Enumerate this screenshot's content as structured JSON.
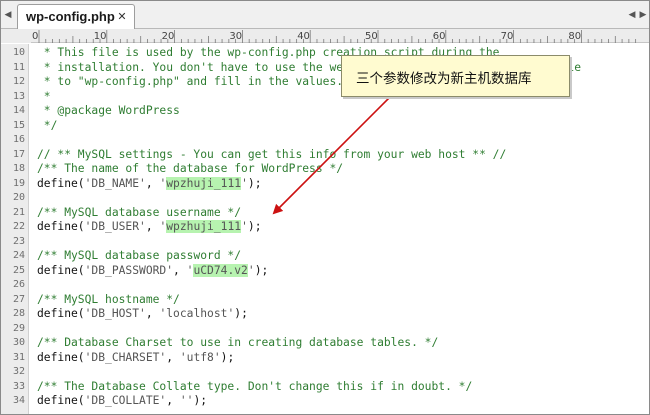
{
  "tab": {
    "title": "wp-config.php"
  },
  "ruler": {
    "labels": [
      "0",
      "10",
      "20",
      "30",
      "40",
      "50",
      "60",
      "70",
      "80"
    ]
  },
  "callout": {
    "text": "三个参数修改为新主机数据库"
  },
  "colors": {
    "comment": "#2f7d32",
    "highlight": "#b7f3b0",
    "callout_bg": "#fffbd0",
    "arrow": "#cc1111"
  },
  "lines": [
    {
      "num": "10",
      "parts": [
        {
          "t": " * This file is used by the wp-config.php creation script during the",
          "c": "c"
        }
      ]
    },
    {
      "num": "11",
      "parts": [
        {
          "t": " * installation. You don't have to use the web site, you can just copy this file",
          "c": "c"
        }
      ]
    },
    {
      "num": "12",
      "parts": [
        {
          "t": " * to \"wp-config.php\" and fill in the values.",
          "c": "c"
        }
      ]
    },
    {
      "num": "13",
      "parts": [
        {
          "t": " *",
          "c": "c"
        }
      ]
    },
    {
      "num": "14",
      "parts": [
        {
          "t": " * @package WordPress",
          "c": "c"
        }
      ]
    },
    {
      "num": "15",
      "parts": [
        {
          "t": " */",
          "c": "c"
        }
      ]
    },
    {
      "num": "16",
      "parts": []
    },
    {
      "num": "17",
      "parts": [
        {
          "t": "// ** MySQL settings - You can get this info from your web host ** //",
          "c": "c"
        }
      ]
    },
    {
      "num": "18",
      "parts": [
        {
          "t": "/** The name of the database for WordPress */",
          "c": "c"
        }
      ]
    },
    {
      "num": "19",
      "parts": [
        {
          "t": "define(",
          "c": "k"
        },
        {
          "t": "'DB_NAME'",
          "c": "s"
        },
        {
          "t": ", ",
          "c": "k"
        },
        {
          "t": "'",
          "c": "s"
        },
        {
          "t": "wpzhuji_111",
          "c": "s hl"
        },
        {
          "t": "'",
          "c": "s"
        },
        {
          "t": ");",
          "c": "k"
        }
      ]
    },
    {
      "num": "20",
      "parts": []
    },
    {
      "num": "21",
      "parts": [
        {
          "t": "/** MySQL database username */",
          "c": "c"
        }
      ]
    },
    {
      "num": "22",
      "parts": [
        {
          "t": "define(",
          "c": "k"
        },
        {
          "t": "'DB_USER'",
          "c": "s"
        },
        {
          "t": ", ",
          "c": "k"
        },
        {
          "t": "'",
          "c": "s"
        },
        {
          "t": "wpzhuji_111",
          "c": "s hl"
        },
        {
          "t": "'",
          "c": "s"
        },
        {
          "t": ");",
          "c": "k"
        }
      ]
    },
    {
      "num": "23",
      "parts": []
    },
    {
      "num": "24",
      "parts": [
        {
          "t": "/** MySQL database password */",
          "c": "c"
        }
      ]
    },
    {
      "num": "25",
      "parts": [
        {
          "t": "define(",
          "c": "k"
        },
        {
          "t": "'DB_PASSWORD'",
          "c": "s"
        },
        {
          "t": ", ",
          "c": "k"
        },
        {
          "t": "'",
          "c": "s"
        },
        {
          "t": "uCD74.v2",
          "c": "s hl"
        },
        {
          "t": "'",
          "c": "s"
        },
        {
          "t": ");",
          "c": "k"
        }
      ]
    },
    {
      "num": "26",
      "parts": []
    },
    {
      "num": "27",
      "parts": [
        {
          "t": "/** MySQL hostname */",
          "c": "c"
        }
      ]
    },
    {
      "num": "28",
      "parts": [
        {
          "t": "define(",
          "c": "k"
        },
        {
          "t": "'DB_HOST'",
          "c": "s"
        },
        {
          "t": ", ",
          "c": "k"
        },
        {
          "t": "'localhost'",
          "c": "s"
        },
        {
          "t": ");",
          "c": "k"
        }
      ]
    },
    {
      "num": "29",
      "parts": []
    },
    {
      "num": "30",
      "parts": [
        {
          "t": "/** Database Charset to use in creating database tables. */",
          "c": "c"
        }
      ]
    },
    {
      "num": "31",
      "parts": [
        {
          "t": "define(",
          "c": "k"
        },
        {
          "t": "'DB_CHARSET'",
          "c": "s"
        },
        {
          "t": ", ",
          "c": "k"
        },
        {
          "t": "'utf8'",
          "c": "s"
        },
        {
          "t": ");",
          "c": "k"
        }
      ]
    },
    {
      "num": "32",
      "parts": []
    },
    {
      "num": "33",
      "parts": [
        {
          "t": "/** The Database Collate type. Don't change this if in doubt. */",
          "c": "c"
        }
      ]
    },
    {
      "num": "34",
      "parts": [
        {
          "t": "define(",
          "c": "k"
        },
        {
          "t": "'DB_COLLATE'",
          "c": "s"
        },
        {
          "t": ", ",
          "c": "k"
        },
        {
          "t": "''",
          "c": "s"
        },
        {
          "t": ");",
          "c": "k"
        }
      ]
    }
  ]
}
